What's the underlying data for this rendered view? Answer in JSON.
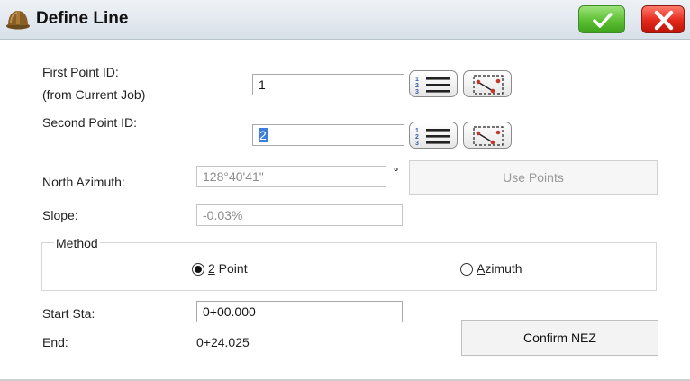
{
  "window": {
    "title": "Define Line",
    "icons": {
      "app": "hardhat-icon",
      "ok": "check-icon",
      "close": "x-icon"
    },
    "colors": {
      "ok": "#5cbf33",
      "close": "#e2281b"
    }
  },
  "first_point": {
    "label_line1": "First Point ID:",
    "label_line2": "(from Current Job)",
    "value": "1"
  },
  "second_point": {
    "label": "Second Point ID:",
    "value": "2"
  },
  "north_azimuth": {
    "label": "North Azimuth:",
    "value": "128°40'41\"",
    "unit": "°"
  },
  "use_points_label": "Use Points",
  "slope": {
    "label": "Slope:",
    "value": "-0.03%"
  },
  "method": {
    "label": "Method",
    "options": [
      {
        "label_first": "2",
        "label_rest": " Point",
        "checked": true
      },
      {
        "label_first": "A",
        "label_rest": "zimuth",
        "checked": false
      }
    ]
  },
  "start_sta": {
    "label": "Start Sta:",
    "value": "0+00.000"
  },
  "end": {
    "label": "End:",
    "value": "0+24.025"
  },
  "confirm_nez_label": "Confirm NEZ"
}
